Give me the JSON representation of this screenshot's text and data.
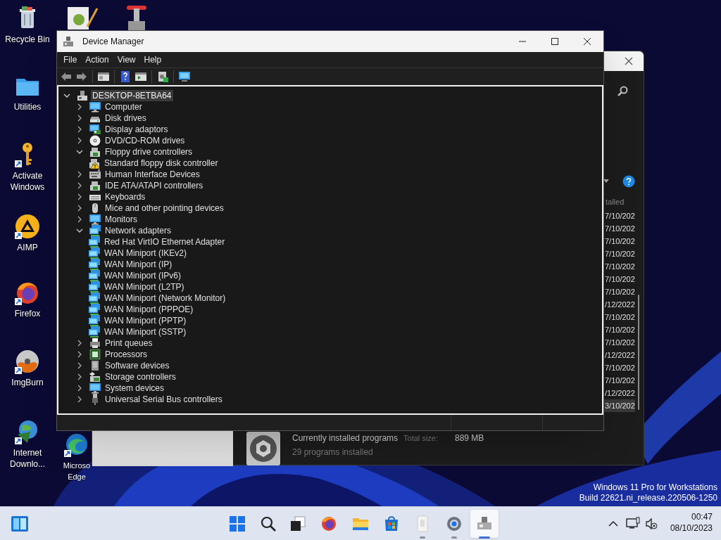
{
  "desktop": {
    "icons": [
      {
        "lines": [
          "Recycle Bin"
        ],
        "kind": "recycle",
        "shortcut": false
      },
      {
        "lines": [
          "Utilities"
        ],
        "kind": "folder",
        "shortcut": false
      },
      {
        "lines": [
          "Activate",
          "Windows"
        ],
        "kind": "key",
        "shortcut": true
      },
      {
        "lines": [
          "AIMP"
        ],
        "kind": "aimp",
        "shortcut": true
      },
      {
        "lines": [
          "Firefox"
        ],
        "kind": "firefox",
        "shortcut": true
      },
      {
        "lines": [
          "ImgBurn"
        ],
        "kind": "disc",
        "shortcut": true
      },
      {
        "lines": [
          "Internet",
          "Downlo..."
        ],
        "kind": "globe",
        "shortcut": true
      },
      {
        "lines": [
          "Microso",
          "Edge"
        ],
        "kind": "edge",
        "shortcut": true
      }
    ]
  },
  "programs_window": {
    "column_header": "talled",
    "dates": [
      {
        "text": "7/10/202",
        "selected": false
      },
      {
        "text": "7/10/202",
        "selected": false
      },
      {
        "text": "7/10/202",
        "selected": false
      },
      {
        "text": "7/10/202",
        "selected": false
      },
      {
        "text": "7/10/202",
        "selected": false
      },
      {
        "text": "7/10/202",
        "selected": false
      },
      {
        "text": "7/10/202",
        "selected": false
      },
      {
        "text": "/12/2022",
        "selected": false
      },
      {
        "text": "7/10/202",
        "selected": false
      },
      {
        "text": "7/10/202",
        "selected": false
      },
      {
        "text": "7/10/202",
        "selected": false
      },
      {
        "text": "/12/2022",
        "selected": false
      },
      {
        "text": "7/10/202",
        "selected": false
      },
      {
        "text": "7/10/202",
        "selected": false
      },
      {
        "text": "/12/2022",
        "selected": false
      },
      {
        "text": "3/10/202",
        "selected": true
      }
    ],
    "summary": {
      "title": "Currently installed programs",
      "size_label": "Total size:",
      "size_value": "889 MB",
      "count": "29 programs installed"
    }
  },
  "device_manager": {
    "title": "Device Manager",
    "menu": [
      "File",
      "Action",
      "View",
      "Help"
    ],
    "tree": {
      "label": "DESKTOP-8ETBA64",
      "kind": "root",
      "expanded": true,
      "selected": true,
      "children": [
        {
          "label": "Computer",
          "kind": "computer",
          "expanded": false,
          "selected": false
        },
        {
          "label": "Disk drives",
          "kind": "disk",
          "expanded": false,
          "selected": false
        },
        {
          "label": "Display adaptors",
          "kind": "display",
          "expanded": false,
          "selected": false
        },
        {
          "label": "DVD/CD-ROM drives",
          "kind": "dvd",
          "expanded": false,
          "selected": false
        },
        {
          "label": "Floppy drive controllers",
          "kind": "controller",
          "expanded": true,
          "selected": false,
          "children": [
            {
              "label": "Standard floppy disk controller",
              "kind": "controller",
              "warning": true,
              "selected": false
            }
          ]
        },
        {
          "label": "Human Interface Devices",
          "kind": "hid",
          "expanded": false,
          "selected": false
        },
        {
          "label": "IDE ATA/ATAPI controllers",
          "kind": "controller",
          "expanded": false,
          "selected": false
        },
        {
          "label": "Keyboards",
          "kind": "keyboard",
          "expanded": false,
          "selected": false
        },
        {
          "label": "Mice and other pointing devices",
          "kind": "mouse",
          "expanded": false,
          "selected": false
        },
        {
          "label": "Monitors",
          "kind": "computer",
          "expanded": false,
          "selected": false
        },
        {
          "label": "Network adapters",
          "kind": "network",
          "expanded": true,
          "selected": false,
          "children": [
            {
              "label": "Red Hat VirtIO Ethernet Adapter",
              "kind": "network",
              "selected": false
            },
            {
              "label": "WAN Miniport (IKEv2)",
              "kind": "network",
              "selected": false
            },
            {
              "label": "WAN Miniport (IP)",
              "kind": "network",
              "selected": false
            },
            {
              "label": "WAN Miniport (IPv6)",
              "kind": "network",
              "selected": false
            },
            {
              "label": "WAN Miniport (L2TP)",
              "kind": "network",
              "selected": false
            },
            {
              "label": "WAN Miniport (Network Monitor)",
              "kind": "network",
              "selected": false
            },
            {
              "label": "WAN Miniport (PPPOE)",
              "kind": "network",
              "selected": false
            },
            {
              "label": "WAN Miniport (PPTP)",
              "kind": "network",
              "selected": false
            },
            {
              "label": "WAN Miniport (SSTP)",
              "kind": "network",
              "selected": false
            }
          ]
        },
        {
          "label": "Print queues",
          "kind": "printer",
          "expanded": false,
          "selected": false
        },
        {
          "label": "Processors",
          "kind": "cpu",
          "expanded": false,
          "selected": false
        },
        {
          "label": "Software devices",
          "kind": "software",
          "expanded": false,
          "selected": false
        },
        {
          "label": "Storage controllers",
          "kind": "storage",
          "expanded": false,
          "selected": false
        },
        {
          "label": "System devices",
          "kind": "computer",
          "expanded": false,
          "selected": false
        },
        {
          "label": "Universal Serial Bus controllers",
          "kind": "usb",
          "expanded": false,
          "selected": false
        }
      ]
    }
  },
  "os_edition": [
    "Windows 11 Pro for Workstations",
    "Build 22621.ni_release.220506-1250"
  ],
  "taskbar": {
    "apps": [
      {
        "kind": "start",
        "running": false,
        "selected": false
      },
      {
        "kind": "search",
        "running": false,
        "selected": false
      },
      {
        "kind": "taskview",
        "running": false,
        "selected": false
      },
      {
        "kind": "firefox",
        "running": false,
        "selected": false
      },
      {
        "kind": "explorer",
        "running": false,
        "selected": false
      },
      {
        "kind": "store",
        "running": false,
        "selected": false
      },
      {
        "kind": "panel",
        "running": true,
        "selected": false
      },
      {
        "kind": "settings",
        "running": true,
        "selected": false
      },
      {
        "kind": "devmgr",
        "running": true,
        "selected": true
      }
    ],
    "clock": {
      "time": "00:47",
      "date": "08/10/2023"
    }
  }
}
